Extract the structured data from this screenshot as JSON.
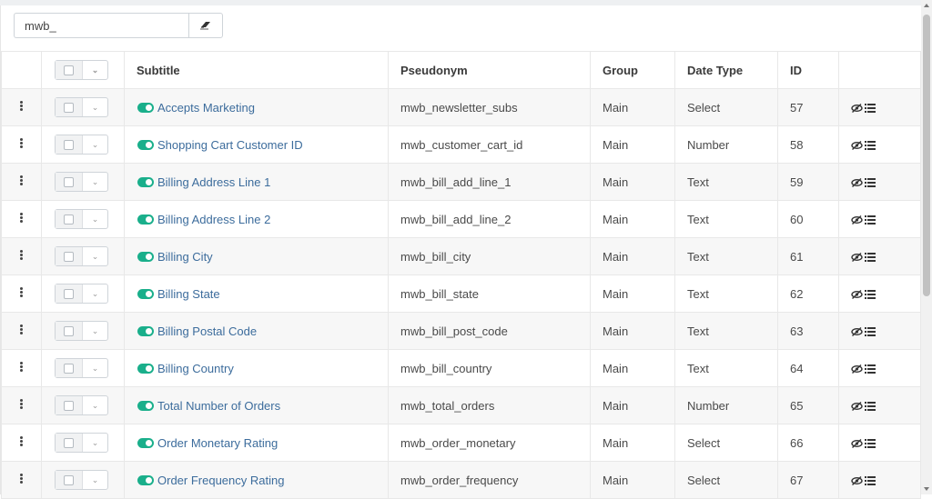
{
  "filter": {
    "value": "mwb_",
    "clear_icon": "eraser-icon"
  },
  "columns": [
    "",
    "",
    "Subtitle",
    "Pseudonym",
    "Group",
    "Date Type",
    "ID",
    ""
  ],
  "rows": [
    {
      "subtitle": "Accepts Marketing",
      "pseudonym": "mwb_newsletter_subs",
      "group": "Main",
      "date_type": "Select",
      "id": "57"
    },
    {
      "subtitle": "Shopping Cart Customer ID",
      "pseudonym": "mwb_customer_cart_id",
      "group": "Main",
      "date_type": "Number",
      "id": "58"
    },
    {
      "subtitle": "Billing Address Line 1",
      "pseudonym": "mwb_bill_add_line_1",
      "group": "Main",
      "date_type": "Text",
      "id": "59"
    },
    {
      "subtitle": "Billing Address Line 2",
      "pseudonym": "mwb_bill_add_line_2",
      "group": "Main",
      "date_type": "Text",
      "id": "60"
    },
    {
      "subtitle": "Billing City",
      "pseudonym": "mwb_bill_city",
      "group": "Main",
      "date_type": "Text",
      "id": "61"
    },
    {
      "subtitle": "Billing State",
      "pseudonym": "mwb_bill_state",
      "group": "Main",
      "date_type": "Text",
      "id": "62"
    },
    {
      "subtitle": "Billing Postal Code",
      "pseudonym": "mwb_bill_post_code",
      "group": "Main",
      "date_type": "Text",
      "id": "63"
    },
    {
      "subtitle": "Billing Country",
      "pseudonym": "mwb_bill_country",
      "group": "Main",
      "date_type": "Text",
      "id": "64"
    },
    {
      "subtitle": "Total Number of Orders",
      "pseudonym": "mwb_total_orders",
      "group": "Main",
      "date_type": "Number",
      "id": "65"
    },
    {
      "subtitle": "Order Monetary Rating",
      "pseudonym": "mwb_order_monetary",
      "group": "Main",
      "date_type": "Select",
      "id": "66"
    },
    {
      "subtitle": "Order Frequency Rating",
      "pseudonym": "mwb_order_frequency",
      "group": "Main",
      "date_type": "Select",
      "id": "67"
    }
  ],
  "colors": {
    "toggle_on": "#1aaf8b",
    "link": "#3c6c9c",
    "row_stripe": "#f7f7f7"
  },
  "icons": {
    "row_handle": "drag-handle-icon",
    "toggle": "toggle-on-icon",
    "action_1": "eye-slash-icon",
    "action_2": "list-icon"
  }
}
